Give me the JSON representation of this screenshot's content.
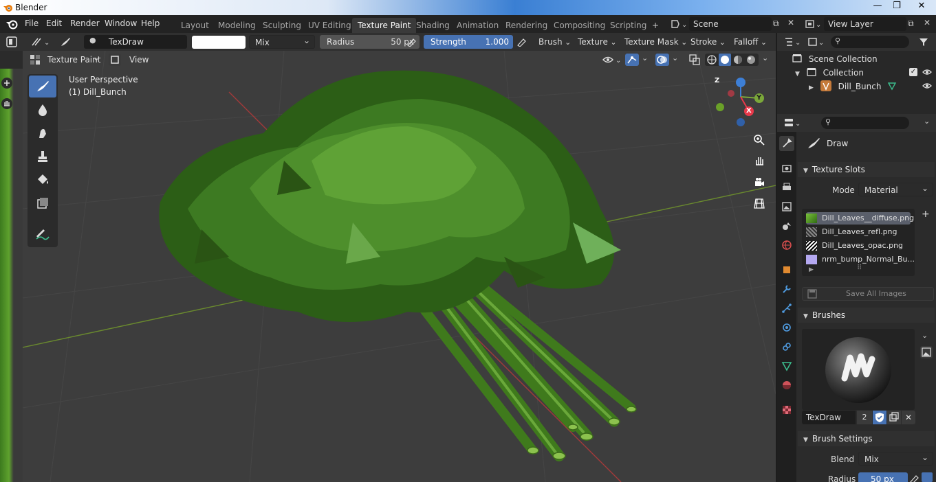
{
  "window": {
    "title": "Blender",
    "minimize": "—",
    "maximize": "❐",
    "close": "✕"
  },
  "menubar": {
    "items": [
      "File",
      "Edit",
      "Render",
      "Window",
      "Help"
    ],
    "workspaces": [
      "Layout",
      "Modeling",
      "Sculpting",
      "UV Editing",
      "Texture Paint",
      "Shading",
      "Animation",
      "Rendering",
      "Compositing",
      "Scripting"
    ],
    "active_workspace": "Texture Paint",
    "add_tab": "+",
    "scene": "Scene",
    "view_layer": "View Layer"
  },
  "tool_settings": {
    "brush_name": "TexDraw",
    "blend": "Mix",
    "radius_label": "Radius",
    "radius_value": "50 px",
    "strength_label": "Strength",
    "strength_value": "1.000",
    "menus": [
      "Brush",
      "Texture",
      "Texture Mask",
      "Stroke",
      "Falloff"
    ]
  },
  "viewport_header": {
    "mode": "Texture Paint",
    "view": "View"
  },
  "viewport": {
    "perspective": "User Perspective",
    "object": "(1) Dill_Bunch",
    "axes": {
      "z": "Z",
      "y": "Y",
      "x": "X"
    }
  },
  "outliner": {
    "root": "Scene Collection",
    "collection": "Collection",
    "object": "Dill_Bunch"
  },
  "properties": {
    "active_tool": "Draw",
    "texture_slots": {
      "title": "Texture Slots",
      "mode_label": "Mode",
      "mode_value": "Material",
      "slots": [
        "Dill_Leaves__diffuse.png",
        "Dill_Leaves_refl.png",
        "Dill_Leaves_opac.png",
        "nrm_bump_Normal_Bu..."
      ],
      "add_button": "+",
      "save_all": "Save All Images"
    },
    "brushes": {
      "title": "Brushes",
      "brush_name": "TexDraw",
      "users": "2"
    },
    "brush_settings": {
      "title": "Brush Settings",
      "blend_label": "Blend",
      "blend_value": "Mix",
      "radius_label": "Radius",
      "radius_value": "50 px"
    }
  },
  "colors": {
    "accent_blue": "#4772b3",
    "header_bg": "#303030",
    "viewport_bg": "#3d3d3d",
    "x_axis": "#e8394a",
    "y_axis": "#7ba83a",
    "z_axis": "#3d7fd6"
  }
}
